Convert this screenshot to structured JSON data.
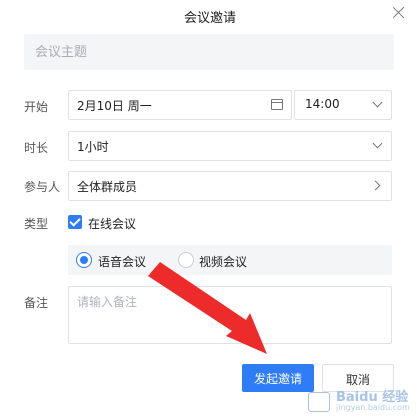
{
  "dialog": {
    "title": "会议邀请",
    "close_label": "×"
  },
  "subject": {
    "placeholder": "会议主题",
    "value": ""
  },
  "rows": {
    "start": {
      "label": "开始",
      "date": "2月10日 周一",
      "time": "14:00"
    },
    "duration": {
      "label": "时长",
      "value": "1小时"
    },
    "participants": {
      "label": "参与人",
      "value": "全体群成员"
    },
    "type": {
      "label": "类型",
      "online_label": "在线会议",
      "online_checked": true,
      "options": [
        {
          "label": "语音会议",
          "selected": true
        },
        {
          "label": "视频会议",
          "selected": false
        }
      ]
    },
    "note": {
      "label": "备注",
      "placeholder": "请输入备注",
      "value": ""
    }
  },
  "buttons": {
    "confirm": "发起邀请",
    "cancel": "取消"
  },
  "watermark": {
    "line1": "Baidu 经验",
    "line2": "jingyan.baidu.com"
  },
  "colors": {
    "accent": "#2e7cf6",
    "arrow": "#ee2b2b",
    "field_bg": "#f4f5f7",
    "border": "#dfe1e5"
  }
}
